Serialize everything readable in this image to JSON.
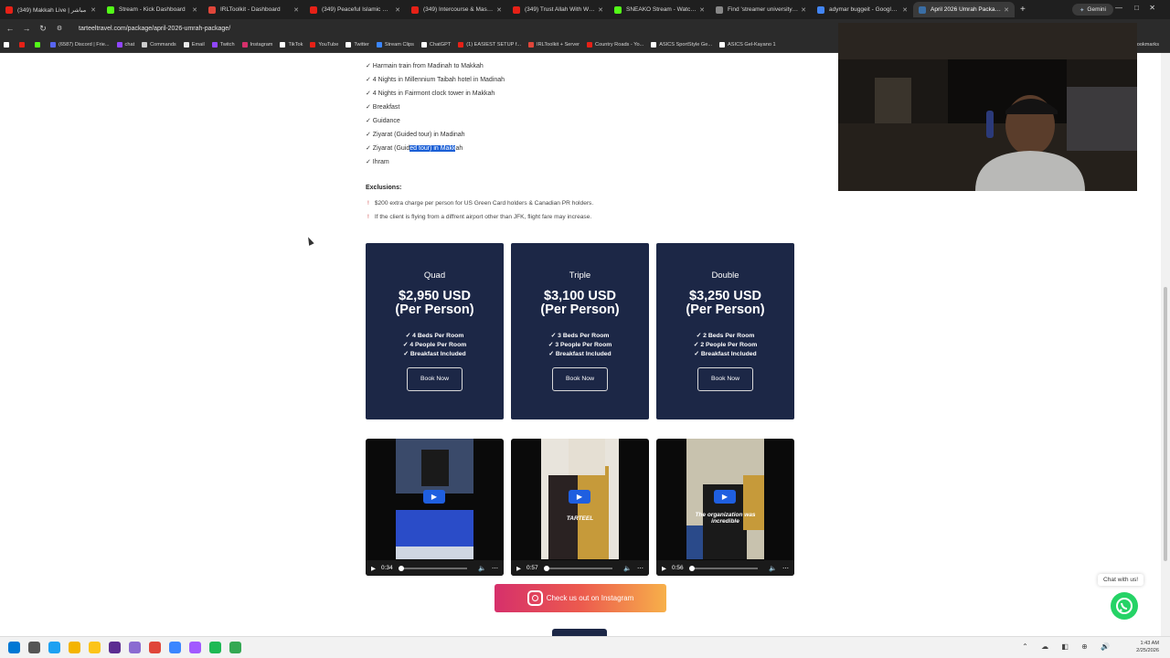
{
  "browser": {
    "tabs": [
      {
        "label": "(349) Makkah Live | مباشر",
        "color": "#e62117"
      },
      {
        "label": "Stream - Kick Dashboard",
        "color": "#53fc18"
      },
      {
        "label": "IRLToolkit - Dashboard",
        "color": "#e0463a"
      },
      {
        "label": "(349) Peaceful Islamic Nashe",
        "color": "#e62117"
      },
      {
        "label": "(349) Intercourse & Masturb",
        "color": "#e62117"
      },
      {
        "label": "(349) Trust Allah With What",
        "color": "#e62117"
      },
      {
        "label": "SNEAKO Stream - Watch Live",
        "color": "#53fc18"
      },
      {
        "label": "Find 'streamer university jor",
        "color": "#888888"
      },
      {
        "label": "adymar buggeit - Google Se",
        "color": "#4285f4"
      },
      {
        "label": "April 2026 Umrah Package",
        "color": "#3a6ea5",
        "active": true
      }
    ],
    "new_tab": "+",
    "gemini_label": "Gemini",
    "url": "tarteeltravel.com/package/april-2026-umrah-package/",
    "bookmarks": [
      {
        "label": "",
        "color": "#ffffff"
      },
      {
        "label": "",
        "color": "#e62117"
      },
      {
        "label": "",
        "color": "#53fc18"
      },
      {
        "label": "(6587) Discord | Frie...",
        "color": "#5865f2"
      },
      {
        "label": "chat",
        "color": "#9146ff"
      },
      {
        "label": "Commands",
        "color": "#cccccc"
      },
      {
        "label": "Email",
        "color": "#e9e9e9"
      },
      {
        "label": "Twitch",
        "color": "#9146ff"
      },
      {
        "label": "Instagram",
        "color": "#d6306b"
      },
      {
        "label": "TikTok",
        "color": "#ffffff"
      },
      {
        "label": "YouTube",
        "color": "#e62117"
      },
      {
        "label": "Twitter",
        "color": "#ffffff"
      },
      {
        "label": "Stream Clips",
        "color": "#3a86ff"
      },
      {
        "label": "ChatGPT",
        "color": "#ffffff"
      },
      {
        "label": "(1) EASIEST SETUP f...",
        "color": "#e62117"
      },
      {
        "label": "IRLToolkit + Server",
        "color": "#e0463a"
      },
      {
        "label": "Country Roads - Yo...",
        "color": "#e62117"
      },
      {
        "label": "ASICS SportStyle Ge...",
        "color": "#ffffff"
      },
      {
        "label": "ASICS Gel-Kayano 1",
        "color": "#ffffff"
      }
    ],
    "all_bookmarks": "Bookmarks"
  },
  "page": {
    "inclusions": [
      "✓ Harmain train from Madinah to Makkah",
      "✓ 4 Nights in Millennium Taibah hotel in Madinah",
      "✓ 4 Nights in Fairmont clock tower in Makkah",
      "✓ Breakfast",
      "✓ Guidance",
      "✓ Ziyarat (Guided tour) in Madinah"
    ],
    "inclusion_highlight": {
      "before": "✓ Ziyarat (Guid",
      "selected": "ed tour) in Makk",
      "after": "ah"
    },
    "inclusion_last": "✓ Ihram",
    "exclusions_heading": "Exclusions:",
    "exclusions": [
      "$200 extra charge per person for US Green Card holders & Canadian PR holders.",
      "If the client is flying from a diffrent airport other than JFK, flight fare may increase."
    ],
    "exclusion_mark": "!",
    "packages": [
      {
        "name": "Quad",
        "price": "$2,950 USD",
        "per": "(Per Person)",
        "features": [
          "✓ 4 Beds Per Room",
          "✓ 4 People Per Room",
          "✓ Breakfast Included"
        ],
        "button": "Book Now"
      },
      {
        "name": "Triple",
        "price": "$3,100 USD",
        "per": "(Per Person)",
        "features": [
          "✓ 3 Beds Per Room",
          "✓ 3 People Per Room",
          "✓ Breakfast Included"
        ],
        "button": "Book Now"
      },
      {
        "name": "Double",
        "price": "$3,250 USD",
        "per": "(Per Person)",
        "features": [
          "✓ 2 Beds Per Room",
          "✓ 2 People Per Room",
          "✓ Breakfast Included"
        ],
        "button": "Book Now"
      }
    ],
    "videos": [
      {
        "time": "0:34",
        "progress": 0.05,
        "caption": ""
      },
      {
        "time": "0:57",
        "progress": 0.05,
        "caption": "TARTEEL"
      },
      {
        "time": "0:56",
        "progress": 0.05,
        "caption": "The organization was incredible"
      }
    ],
    "instagram_label": "Check us out on Instagram",
    "chat_label": "Chat with us!"
  },
  "taskbar": {
    "icons": [
      "#0078d4",
      "#555555",
      "#1da1f2",
      "#f4b400",
      "#fcc419",
      "#5c2d91",
      "#8a6bd1",
      "#e0463a",
      "#3a86ff",
      "#a259ff",
      "#1db954",
      "#34a853"
    ],
    "time": "1:43 AM",
    "date": "2/25/2026",
    "tray": "⌃ ☁ ◧ ⊕ 🔊"
  },
  "colors": {
    "card_bg": "#1c2746",
    "highlight": "#1a5fd6"
  }
}
